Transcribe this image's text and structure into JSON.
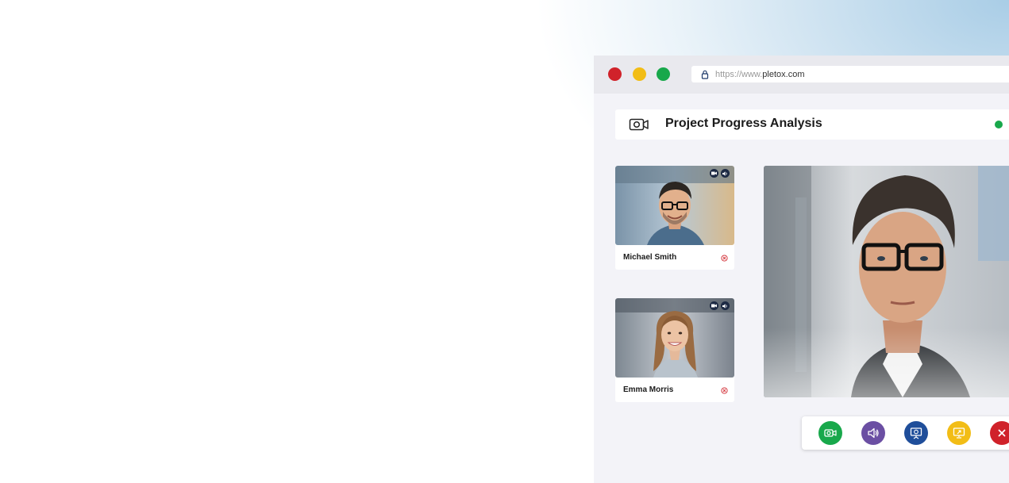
{
  "browser": {
    "url_host": "https://www.",
    "url_domain": "pletox.com"
  },
  "meeting": {
    "title": "Project Progress Analysis",
    "status_color": "#18a84b"
  },
  "participants": [
    {
      "name": "Michael Smith"
    },
    {
      "name": "Emma Morris"
    }
  ],
  "controls": [
    {
      "icon": "camera-icon",
      "color": "#18a84b"
    },
    {
      "icon": "speaker-icon",
      "color": "#6b4fa3"
    },
    {
      "icon": "presentation-icon",
      "color": "#1f4e9a"
    },
    {
      "icon": "screen-share-icon",
      "color": "#f2bd16"
    },
    {
      "icon": "close-icon",
      "color": "#d0222a"
    }
  ]
}
